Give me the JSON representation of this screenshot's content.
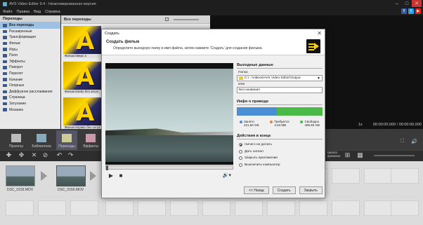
{
  "window": {
    "title": "AVS Video Editor 9.4 - Неактивированная версия"
  },
  "menu": [
    "Файл",
    "Правка",
    "Вид",
    "Справка"
  ],
  "social": [
    {
      "name": "facebook-icon",
      "letter": "f",
      "color": "#3b5998"
    },
    {
      "name": "twitter-icon",
      "letter": "t",
      "color": "#1da1f2"
    },
    {
      "name": "youtube-icon",
      "letter": "▶",
      "color": "#e62117"
    }
  ],
  "left_panel": {
    "header": "Переходы",
    "items": [
      "Все переходы",
      "Расширенные",
      "Трансформация",
      "Фильм",
      "Игры",
      "Поля",
      "Эффекты",
      "Поворот",
      "Перелет",
      "Качание",
      "Опорные",
      "Диффузное расслаивание",
      "Страница",
      "Затухание",
      "Мозаика"
    ]
  },
  "mid_panel": {
    "header": "Все переходы",
    "thumbs": [
      {
        "label": "Фильм вверх 2"
      },
      {
        "label": "Фильм влево без затух"
      },
      {
        "label": "Фильм вправо без затух"
      }
    ]
  },
  "toolbar": {
    "tools": [
      {
        "name": "projects-tool",
        "label": "Проекты"
      },
      {
        "name": "library-tool",
        "label": "Библиотека"
      },
      {
        "name": "transitions-tool",
        "label": "Переходы"
      },
      {
        "name": "effects-tool",
        "label": "Эффекты"
      }
    ],
    "speed": "1x",
    "time": "00:00:00.000 / 00:00:00.000",
    "zoom_label": "Шкала времени"
  },
  "timeline": {
    "clips": [
      {
        "label": "DSC_0159.MOV"
      },
      {
        "label": "DSC_0159.MOV"
      }
    ]
  },
  "dialog": {
    "title": "Создать",
    "heading": "Создать фильм",
    "subtitle": "Определите выходную папку и имя файла, затем нажмите 'Создать' для создания фильма.",
    "output": {
      "section": "Выходные данные",
      "folder_label": "Папка",
      "folder_value": "C:\\...\\Videos\\AVS Video Editor\\Output",
      "name_label": "Имя",
      "name_value": "Без названия"
    },
    "drive": {
      "section": "Инфо о приводе",
      "used_fraction": 0.47,
      "used": {
        "label": "Занято",
        "value": "421,60 GB"
      },
      "required": {
        "label": "Требуется",
        "value": "2,63 MB"
      },
      "free": {
        "label": "Свободно",
        "value": "496,50 GB"
      }
    },
    "after": {
      "section": "Действия в конце",
      "options": [
        "Ничего не делать",
        "Дать сигнал",
        "Закрыть приложение",
        "Выключить компьютер"
      ],
      "selected": 0
    },
    "buttons": {
      "back": "<< Назад",
      "create": "Создать",
      "close": "Закрыть"
    }
  }
}
